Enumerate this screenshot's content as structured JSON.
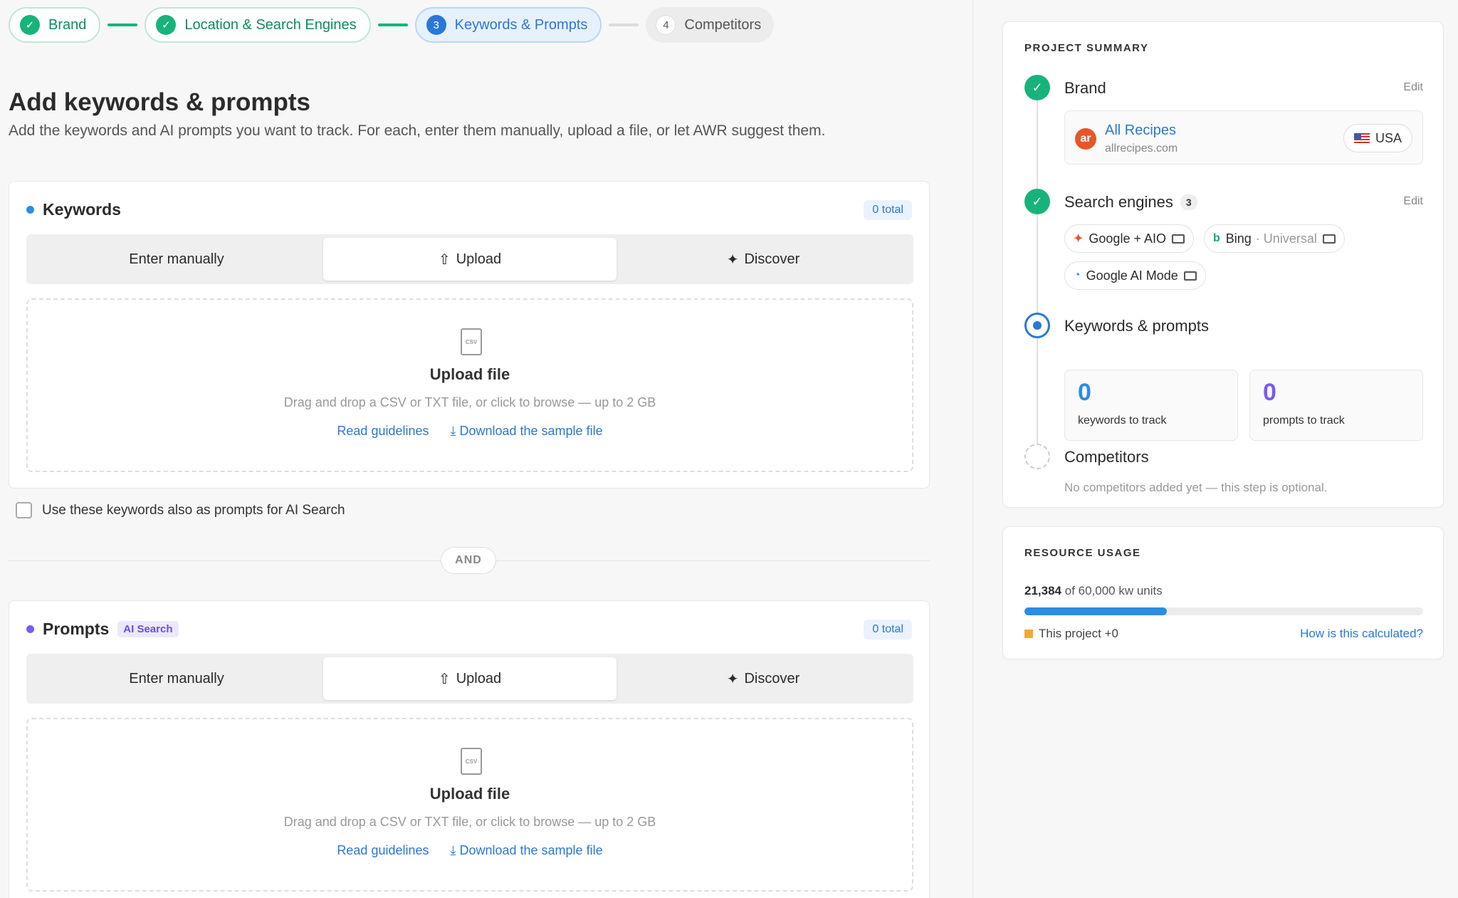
{
  "stepper": {
    "steps": [
      {
        "num": "✓",
        "label": "Brand"
      },
      {
        "num": "✓",
        "label": "Location & Search Engines"
      },
      {
        "num": "3",
        "label": "Keywords & Prompts"
      },
      {
        "num": "4",
        "label": "Competitors"
      }
    ]
  },
  "page": {
    "title": "Add keywords & prompts",
    "subtitle": "Add the keywords and AI prompts you want to track. For each, enter them manually, upload a file, or let AWR suggest them."
  },
  "keywords": {
    "title": "Keywords",
    "total": "0 total",
    "tabs": {
      "manual": "Enter manually",
      "upload": "Upload",
      "discover": "Discover"
    },
    "drop": {
      "file_tag": "CSV",
      "title": "Upload file",
      "sub": "Drag and drop a CSV or TXT file, or click to browse — up to 2 GB",
      "guidelines": "Read guidelines",
      "sample": "Download the sample file"
    }
  },
  "checkbox_label": "Use these keywords also as prompts for AI Search",
  "and_label": "AND",
  "prompts": {
    "title": "Prompts",
    "badge": "AI Search",
    "total": "0 total",
    "tabs": {
      "manual": "Enter manually",
      "upload": "Upload",
      "discover": "Discover"
    },
    "drop": {
      "file_tag": "CSV",
      "title": "Upload file",
      "sub": "Drag and drop a CSV or TXT file, or click to browse — up to 2 GB",
      "guidelines": "Read guidelines",
      "sample": "Download the sample file"
    }
  },
  "summary": {
    "heading": "PROJECT SUMMARY",
    "edit": "Edit",
    "brand": {
      "title": "Brand",
      "logo_text": "ar",
      "name": "All Recipes",
      "url": "allrecipes.com",
      "country": "USA"
    },
    "engines": {
      "title": "Search engines",
      "count": "3",
      "items": [
        {
          "name": "Google + AIO",
          "extra": ""
        },
        {
          "name": "Bing",
          "extra": "· Universal"
        },
        {
          "name": "Google AI Mode",
          "extra": ""
        }
      ]
    },
    "kp": {
      "title": "Keywords & prompts",
      "keywords_count": "0",
      "keywords_label": "keywords to track",
      "prompts_count": "0",
      "prompts_label": "prompts to track"
    },
    "competitors": {
      "title": "Competitors",
      "note": "No competitors added yet — this step is optional."
    }
  },
  "usage": {
    "heading": "RESOURCE USAGE",
    "used": "21,384",
    "of_text": "of 60,000 kw units",
    "fraction": 0.3564,
    "legend": "This project +0",
    "link": "How is this calculated?"
  },
  "colors": {
    "accent": "#2a78d6",
    "success": "#17b37b",
    "keywords_dot": "#2a8de6",
    "prompts_dot": "#7a5af0"
  }
}
